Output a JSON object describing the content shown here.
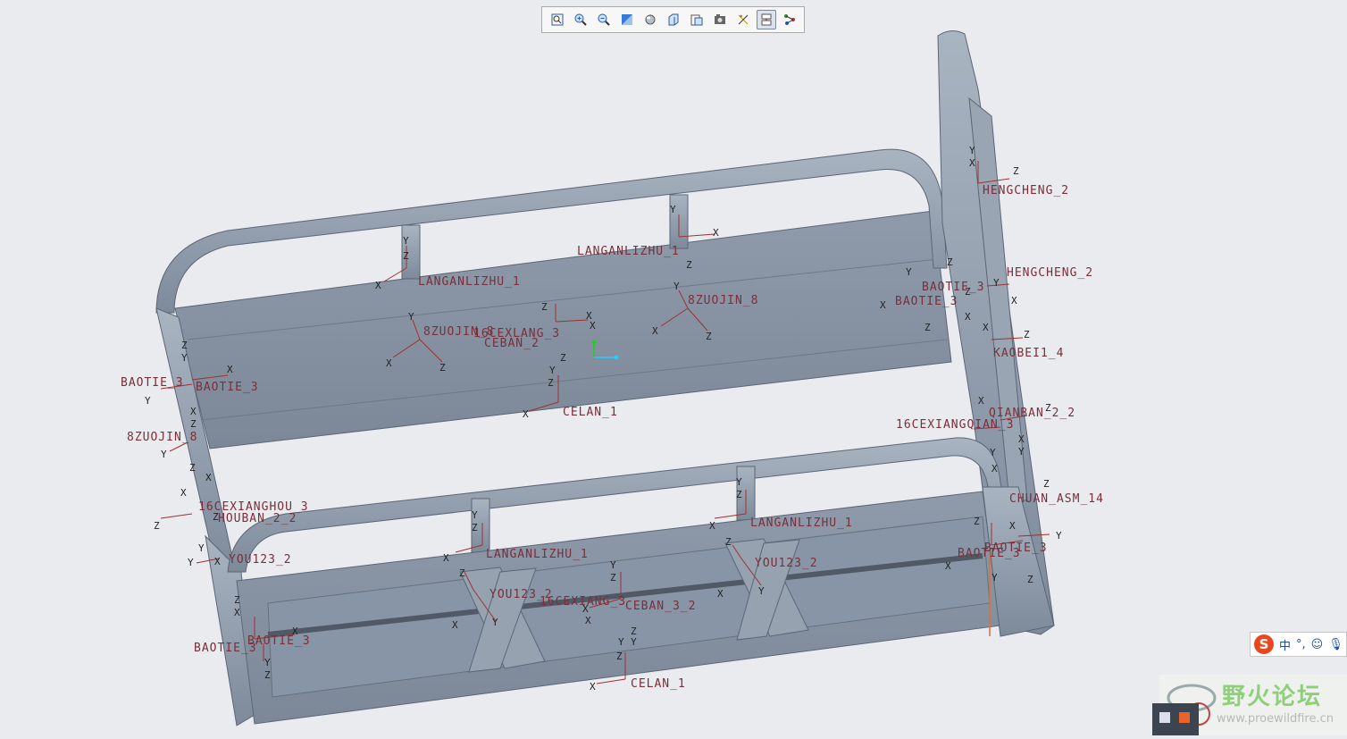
{
  "toolbar": {
    "buttons": [
      {
        "name": "refit-icon",
        "tip": "Refit"
      },
      {
        "name": "zoom-in-icon",
        "tip": "Zoom In"
      },
      {
        "name": "zoom-out-icon",
        "tip": "Zoom Out"
      },
      {
        "name": "repaint-icon",
        "tip": "Repaint"
      },
      {
        "name": "display-style-icon",
        "tip": "Display Style"
      },
      {
        "name": "saved-views-icon",
        "tip": "Saved Orientations"
      },
      {
        "name": "view-manager-icon",
        "tip": "View Manager"
      },
      {
        "name": "perspective-icon",
        "tip": "Perspective"
      },
      {
        "name": "datum-display-icon",
        "tip": "Datum Display"
      },
      {
        "name": "annotation-display-icon",
        "tip": "Annotation Display"
      },
      {
        "name": "spin-center-icon",
        "tip": "Spin Center"
      }
    ]
  },
  "labels": {
    "hengcheng_top": "HENGCHENG_2",
    "hengcheng_mid": "HENGCHENG_2",
    "langanlizhu_back_left": "LANGANLIZHU_1",
    "langanlizhu_back_right": "LANGANLIZHU_1",
    "zuojin_left": "8ZUOJIN_8",
    "zuojin_right": "8ZUOJIN_8",
    "cexlang": "16CEXLANG_3",
    "ceban_back": "CEBAN_2",
    "celan_back": "CELAN_1",
    "baotie_r1": "BAOTIE_3",
    "baotie_r2": "BAOTIE_3",
    "kaobei": "KAOBEI1_4",
    "qianban": "QIANBAN_2_2",
    "cexiangqian": "16CEXIANGQIAN_3",
    "baotie_l1": "BAOTIE_3",
    "baotie_l2": "BAOTIE_3",
    "zuojin_l": "8ZUOJIN_8",
    "cexianghou": "16CEXIANGHOU_3",
    "houban": "HOUBAN_2_2",
    "you_left": "YOU123_2",
    "langanlizhu_front_left": "LANGANLIZHU_1",
    "langanlizhu_front_right": "LANGANLIZHU_1",
    "you_mid": "YOU123_2",
    "you_right": "YOU123_2",
    "xiangsan": "16CEXIANG_3",
    "ceban_front": "CEBAN_3_2",
    "celan_front": "CELAN_1",
    "baotie_bl1": "BAOTIE_3",
    "baotie_bl2": "BAOTIE_3",
    "baotie_br1": "BAOTIE_3",
    "baotie_br2": "BAOTIE_3",
    "chuan_asm": "CHUAN_ASM_14"
  },
  "ime": {
    "lang": "中",
    "punct": "°,"
  },
  "watermark": {
    "title": "野火论坛",
    "url": "www.proewildfire.cn"
  },
  "colors": {
    "background": "#e9ebef",
    "model": "#8b98a8",
    "label": "#7a2f3a",
    "axis": "#a03030"
  }
}
